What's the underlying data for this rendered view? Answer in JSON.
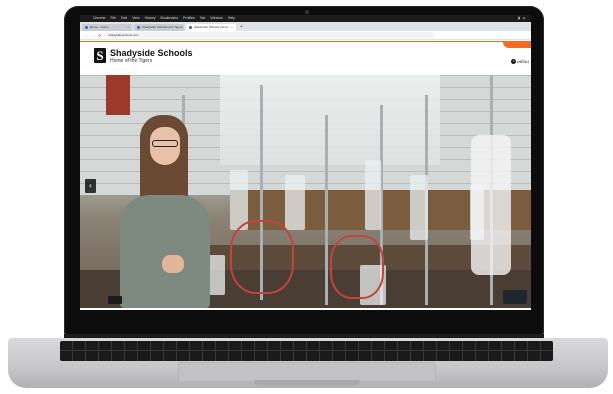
{
  "menubar": {
    "apple": "",
    "items": [
      "Chrome",
      "File",
      "Edit",
      "View",
      "History",
      "Bookmarks",
      "Profiles",
      "Tab",
      "Window",
      "Help"
    ]
  },
  "tabs": [
    {
      "label": "Home - Home",
      "active": false
    },
    {
      "label": "Shadyside Schools and Tigers",
      "active": false
    },
    {
      "label": "Shadyside Schools Home",
      "active": true
    }
  ],
  "newtab_label": "+",
  "address": {
    "url": "shadysideschools.com",
    "back": "←",
    "forward": "→",
    "reload": "⟳"
  },
  "site": {
    "logo_letter": "S",
    "name": "Shadyside Schools",
    "tagline": "Home of the Tigers",
    "menu_label": "MENU"
  },
  "hero": {
    "prev_arrow": "‹"
  },
  "colors": {
    "brand_orange": "#f26b21",
    "logo_black": "#111111"
  }
}
